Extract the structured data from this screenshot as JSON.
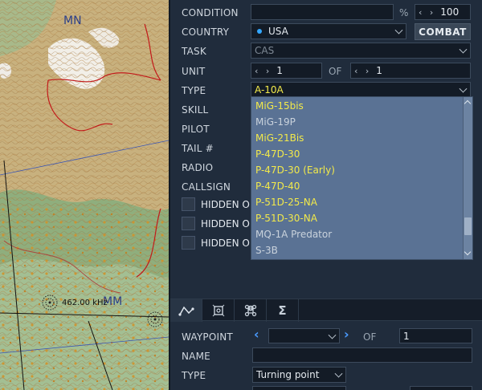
{
  "map": {
    "labels": {
      "mn": "MN",
      "mm": "MM"
    },
    "frequency": "462.00 kHz"
  },
  "group": {
    "condition": {
      "label": "CONDITION",
      "value": "",
      "percent_sign": "%",
      "percent_value": "100"
    },
    "country": {
      "label": "COUNTRY",
      "value": "USA",
      "combat_button": "COMBAT",
      "flag_color": "#33a7ff"
    },
    "task": {
      "label": "TASK",
      "value": "CAS"
    },
    "unit": {
      "label": "UNIT",
      "value": "1",
      "of_label": "OF",
      "of_value": "1"
    },
    "type": {
      "label": "TYPE",
      "value": "A-10A"
    },
    "skill": {
      "label": "SKILL"
    },
    "pilot": {
      "label": "PILOT"
    },
    "tail": {
      "label": "TAIL #"
    },
    "radio": {
      "label": "RADIO"
    },
    "callsign": {
      "label": "CALLSIGN"
    },
    "hidden": [
      "HIDDEN O",
      "HIDDEN O",
      "HIDDEN O"
    ]
  },
  "type_options": [
    {
      "label": "MiG-15bis",
      "color": "yellow"
    },
    {
      "label": "MiG-19P",
      "color": "grey"
    },
    {
      "label": "MiG-21Bis",
      "color": "yellow"
    },
    {
      "label": "P-47D-30",
      "color": "yellow"
    },
    {
      "label": "P-47D-30 (Early)",
      "color": "yellow"
    },
    {
      "label": "P-47D-40",
      "color": "yellow"
    },
    {
      "label": "P-51D-25-NA",
      "color": "yellow"
    },
    {
      "label": "P-51D-30-NA",
      "color": "yellow"
    },
    {
      "label": "MQ-1A Predator",
      "color": "grey"
    },
    {
      "label": "S-3B",
      "color": "grey"
    }
  ],
  "tabs": [
    "route-icon",
    "target-icon",
    "command-icon",
    "sigma-icon"
  ],
  "waypoint": {
    "label": "WAYPOINT",
    "value": "",
    "of_label": "OF",
    "of_value": "1",
    "name_label": "NAME",
    "name_value": "",
    "type_label": "TYPE",
    "type_value": "Turning point"
  }
}
